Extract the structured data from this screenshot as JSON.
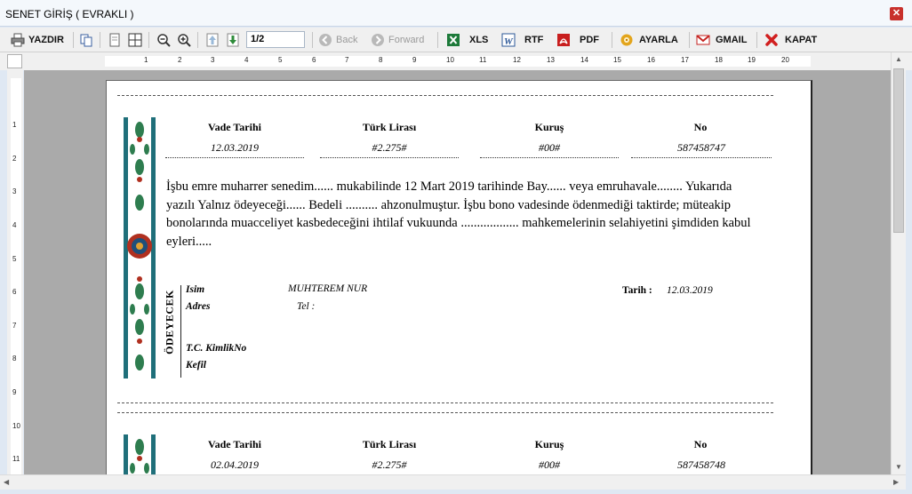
{
  "window": {
    "title": "SENET GİRİŞ ( EVRAKLI )"
  },
  "toolbar": {
    "print": "YAZDIR",
    "page_value": "1/2",
    "back": "Back",
    "forward": "Forward",
    "xls": "XLS",
    "rtf": "RTF",
    "pdf": "PDF",
    "settings": "AYARLA",
    "gmail": "GMAIL",
    "close": "KAPAT"
  },
  "ruler": {
    "h_labels": [
      "1",
      "2",
      "3",
      "4",
      "5",
      "6",
      "7",
      "8",
      "9",
      "10",
      "11",
      "12",
      "13",
      "14",
      "15",
      "16",
      "17",
      "18",
      "19",
      "20"
    ],
    "v_labels": [
      "1",
      "2",
      "3",
      "4",
      "5",
      "6",
      "7",
      "8",
      "9",
      "10",
      "11"
    ]
  },
  "colors": {
    "accent_teal": "#1f6f7a",
    "ornament_red": "#b03020",
    "ornament_green": "#2e7d4f"
  },
  "notes": [
    {
      "headers": {
        "date": "Vade Tarihi",
        "amount_tl": "Türk Lirası",
        "amount_kurus": "Kuruş",
        "number": "No"
      },
      "values": {
        "date": "12.03.2019",
        "amount_tl": "#2.275#",
        "amount_kurus": "#00#",
        "number": "587458747"
      },
      "body": "İşbu emre muharrer senedim...... mukabilinde 12 Mart 2019 tarihinde Bay......     veya emruhavale........ Yukarıda yazılı Yalnız  ödeyeceği...... Bedeli .......... ahzonulmuştur. İşbu bono vadesinde ödenmediği taktirde; müteakip bonolarında muacceliyet kasbedeceğini ihtilaf vukuunda .................. mahkemelerinin selahiyetini şimdiden kabul eyleri.....",
      "debtor_title": "ÖDEYECEK",
      "labels": {
        "name": "Isim",
        "address": "Adres",
        "phone": "Tel :",
        "tc": "T.C. KimlikNo",
        "guarantor": "Kefil",
        "date": "Tarih  :"
      },
      "name_value": "MUHTEREM NUR",
      "date_value": "12.03.2019"
    },
    {
      "headers": {
        "date": "Vade Tarihi",
        "amount_tl": "Türk Lirası",
        "amount_kurus": "Kuruş",
        "number": "No"
      },
      "values": {
        "date": "02.04.2019",
        "amount_tl": "#2.275#",
        "amount_kurus": "#00#",
        "number": "587458748"
      }
    }
  ]
}
